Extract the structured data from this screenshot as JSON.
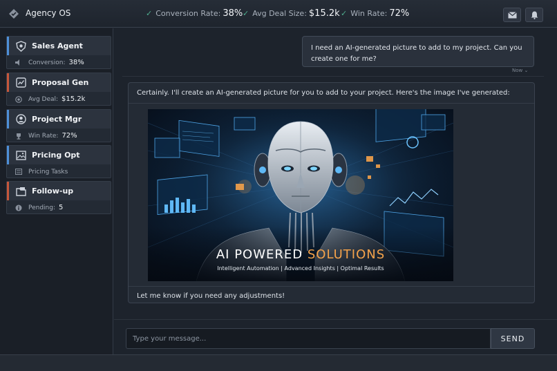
{
  "app": {
    "title": "Agency OS",
    "logo_icon": "diamond-logo-icon"
  },
  "header": {
    "kpis": [
      {
        "label": "Conversion Rate:",
        "value": "38%"
      },
      {
        "label": "Avg Deal Size:",
        "value": "$15.2k"
      },
      {
        "label": "Win Rate:",
        "value": "72%"
      }
    ],
    "actions": [
      "mail-icon",
      "bell-icon"
    ]
  },
  "sidebar": {
    "agents": [
      {
        "name": "Sales Agent",
        "stat_label": "Conversion:",
        "stat_value": "38%",
        "icon": "shield-icon",
        "accent": "#4e90d9"
      },
      {
        "name": "Proposal Gen",
        "stat_label": "Avg Deal:",
        "stat_value": "$15.2k",
        "icon": "document-icon",
        "accent": "#c7573b"
      },
      {
        "name": "Project Mgr",
        "stat_label": "Win Rate:",
        "stat_value": "72%",
        "icon": "user-icon",
        "accent": "#4e90d9"
      },
      {
        "name": "Pricing Opt",
        "stat_label": "Pricing Tasks",
        "stat_value": "",
        "icon": "image-icon",
        "accent": "#4e90d9"
      },
      {
        "name": "Follow-up",
        "stat_label": "Pending:",
        "stat_value": "5",
        "icon": "folder-icon",
        "accent": "#c7573b"
      }
    ]
  },
  "chat": {
    "user_message": "I need an AI-generated picture to add to my project. Can you create one for me?",
    "user_time": "Now",
    "bot_intro": "Certainly. I'll create an AI-generated picture for you to add to your project. Here's the image I've generated:",
    "image": {
      "title_main": "AI POWERED",
      "title_accent": "SOLUTIONS",
      "subtitle": "Intelligent Automation  |  Advanced Insights  |  Optimal Results"
    },
    "bot_outro": "Let me know if you need any adjustments!"
  },
  "composer": {
    "placeholder": "Type your message...",
    "send_label": "SEND"
  },
  "colors": {
    "background": "#1d232c",
    "accent_blue": "#4e90d9",
    "accent_red": "#c7573b",
    "check_green": "#4fae8f",
    "title_orange": "#f4a24a"
  }
}
